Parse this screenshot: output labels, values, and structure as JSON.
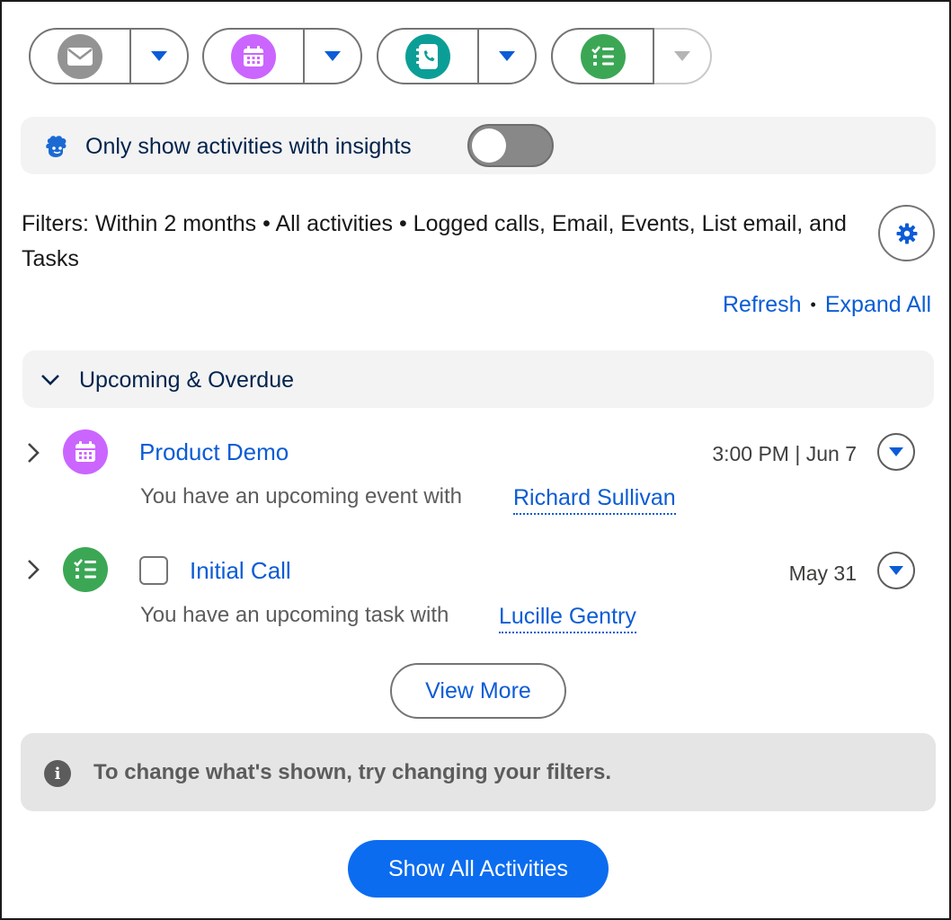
{
  "actions": [
    {
      "name": "email",
      "icon": "email-icon",
      "color": "#939393"
    },
    {
      "name": "event",
      "icon": "calendar-icon",
      "color": "#cb65ff"
    },
    {
      "name": "call",
      "icon": "phone-icon",
      "color": "#0b9e97"
    },
    {
      "name": "task",
      "icon": "task-list-icon",
      "color": "#3ba755"
    }
  ],
  "insights": {
    "label": "Only show activities with insights",
    "toggle_on": false
  },
  "filters": {
    "text": "Filters: Within 2 months • All activities • Logged calls, Email, Events, List email, and Tasks"
  },
  "links": {
    "refresh": "Refresh",
    "expand_all": "Expand All",
    "separator": "•"
  },
  "section": {
    "title": "Upcoming & Overdue"
  },
  "items": [
    {
      "subject": "Product Demo",
      "date": "3:00 PM | Jun 7",
      "description": "You have an upcoming event with",
      "person": "Richard Sullivan",
      "icon": "calendar-icon",
      "icon_color": "#cb65ff"
    },
    {
      "subject": "Initial Call",
      "date": "May 31",
      "description": "You have an upcoming task with",
      "person": "Lucille Gentry",
      "icon": "task-list-icon",
      "icon_color": "#3ba755"
    }
  ],
  "view_more": "View More",
  "notice": {
    "message": "To change what's shown, try changing your filters.",
    "icon": "info-icon"
  },
  "show_all": "Show All Activities",
  "colors": {
    "brand": "#0b5cd6",
    "primary_button": "#0b6cf0"
  }
}
